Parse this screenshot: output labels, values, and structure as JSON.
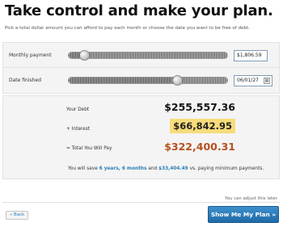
{
  "header": {
    "title": "Take control and make your plan.",
    "subtitle": "Pick a total dollar amount you can afford to pay each month or choose the date you want to be free of debt."
  },
  "monthly_payment": {
    "label": "Monthly payment",
    "value": "$1,806.59",
    "slider_level": 0.1
  },
  "date_finished": {
    "label": "Date finished",
    "value": "06/01/27",
    "slider_level": 0.68
  },
  "summary": {
    "debt_label": "Your Debt",
    "debt_amount": "$255,557.36",
    "interest_label": "+ Interest",
    "interest_amount": "$66,842.95",
    "total_label": "= Total You Will Pay",
    "total_amount": "$322,400.31",
    "save_prefix": "You will save",
    "save_time": "6 years, 6 months",
    "save_and": "and",
    "save_money": "$33,404.49",
    "save_suffix": "vs. paying minimum payments."
  },
  "footer": {
    "adjust_note": "You can adjust this later.",
    "back_label": "« Back",
    "primary_label": "Show Me My Plan »"
  },
  "colors": {
    "accent_blue": "#2e7fb8",
    "interest_highlight": "#f7dc7a",
    "total_color": "#b5501f"
  }
}
